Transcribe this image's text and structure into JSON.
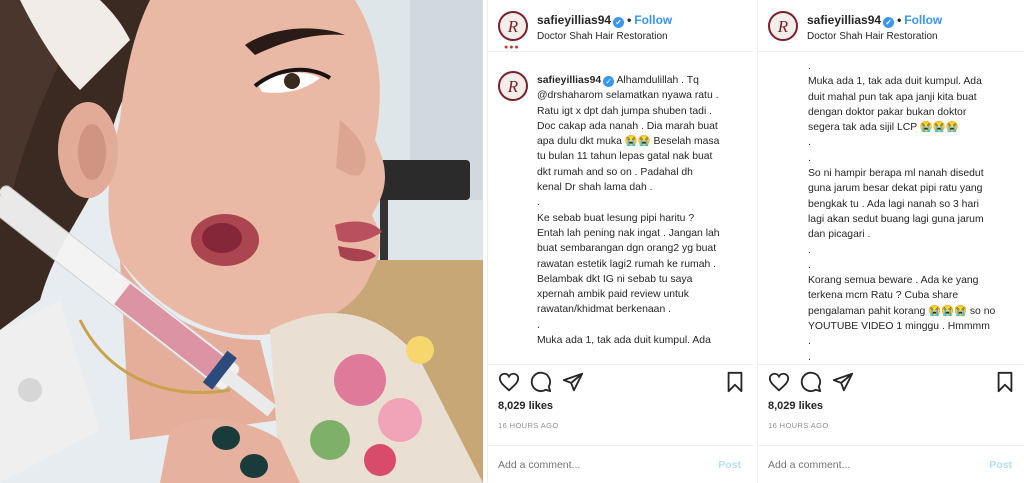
{
  "colors": {
    "accent": "#3897f0",
    "text": "#262626",
    "muted": "#8e8e8e",
    "divider": "#efefef",
    "brand": "#7b1f2b"
  },
  "profile": {
    "avatar_monogram": "R",
    "username": "safieyillias94",
    "verified": true,
    "dot": "•",
    "follow_label": "Follow",
    "location": "Doctor Shah Hair Restoration"
  },
  "post1": {
    "caption_lines": [
      "Alhamdulillah . Tq",
      "@drshaharom selamatkan nyawa ratu .",
      "Ratu igt x dpt dah jumpa shuben tadi .",
      "Doc cakap ada nanah . Dia marah buat",
      "apa dulu dkt muka 😭😭 Beselah masa",
      "tu bulan 11 tahun lepas gatal nak buat",
      "dkt rumah and so on . Padahal dh",
      "kenal Dr shah lama dah .",
      ".",
      "Ke sebab buat lesung pipi haritu ?",
      "Entah lah pening nak ingat . Jangan lah",
      "buat sembarangan dgn orang2 yg buat",
      "rawatan estetik lagi2 rumah ke rumah .",
      "Belambak dkt IG ni sebab tu saya",
      "xpernah ambik paid review untuk",
      "rawatan/khidmat berkenaan .",
      ".",
      "Muka ada 1, tak ada duit kumpul. Ada"
    ],
    "likes": "8,029 likes",
    "time": "16 HOURS AGO",
    "comment_placeholder": "Add a comment...",
    "post_label": "Post"
  },
  "post2": {
    "caption_lines": [
      ".",
      "Muka ada 1, tak ada duit kumpul. Ada",
      "duit mahal pun tak apa janji kita buat",
      "dengan doktor pakar bukan doktor",
      "segera tak ada sijil LCP 😭😭😭",
      ".",
      ".",
      "So ni hampir berapa ml nanah disedut",
      "guna jarum besar dekat pipi ratu yang",
      "bengkak tu . Ada lagi nanah so 3 hari",
      "lagi akan sedut buang lagi guna jarum",
      "dan picagari .",
      ".",
      ".",
      "Korang semua beware . Ada ke yang",
      "terkena mcm Ratu ? Cuba share",
      "pengalaman pahit korang 😭😭😭 so no",
      "YOUTUBE VIDEO 1 minggu . Hmmmm",
      ".",
      "."
    ],
    "likes": "8,029 likes",
    "time": "16 HOURS AGO",
    "comment_placeholder": "Add a comment...",
    "post_label": "Post"
  },
  "icons": [
    "heart-icon",
    "comment-icon",
    "share-icon",
    "bookmark-icon"
  ]
}
